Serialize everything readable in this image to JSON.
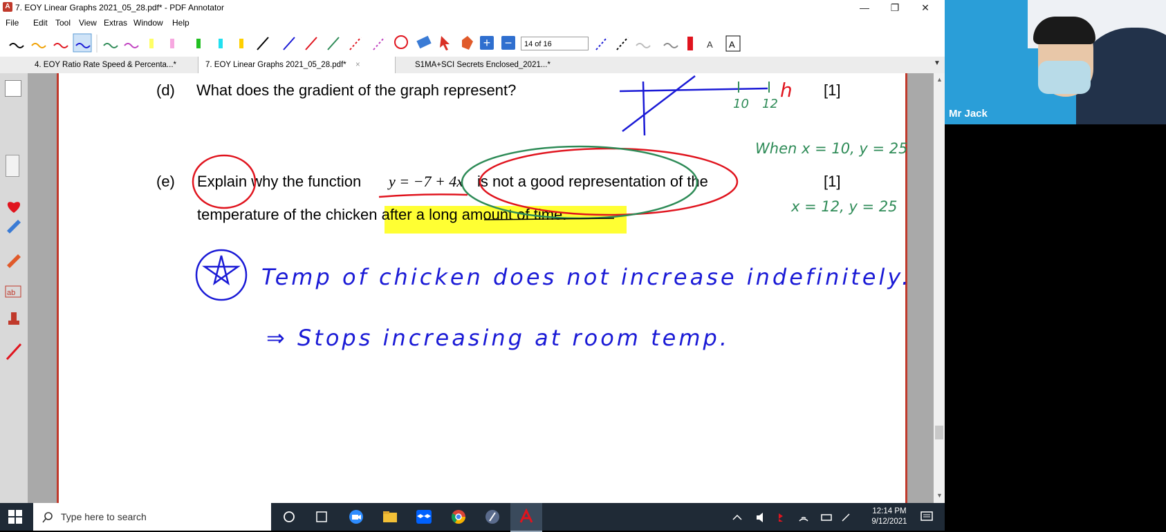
{
  "window": {
    "title": "7. EOY Linear Graphs 2021_05_28.pdf* - PDF Annotator",
    "controls": [
      "—",
      "❐",
      "✕"
    ]
  },
  "menu": [
    "File",
    "Edit",
    "Tool",
    "View",
    "Extras",
    "Window",
    "Help"
  ],
  "toolbar": {
    "page_indicator": "14 of 16",
    "plus_label": "+",
    "minus_label": "−"
  },
  "tabs": [
    {
      "label": "4. EOY Ratio Rate Speed & Percenta...*",
      "active": false
    },
    {
      "label": "7. EOY Linear Graphs 2021_05_28.pdf*",
      "active": true
    },
    {
      "label": "S1MA+SCI Secrets Enclosed_2021...*",
      "active": false
    }
  ],
  "document": {
    "q_d_label": "(d)",
    "q_d_text": "What does the gradient of the graph represent?",
    "q_d_marks": "[1]",
    "q_e_label": "(e)",
    "q_e_text_1a": "Explain why the function",
    "q_e_formula": "y = −7 + 4x",
    "q_e_text_1b": "is not a good representation of the",
    "q_e_text_2": "temperature of the chicken after a long amount of time.",
    "q_e_marks": "[1]",
    "ink_green_1": "When x = 10, y = 25",
    "ink_green_2": "x = 12, y = 25",
    "ink_axis_10": "10",
    "ink_axis_12": "12",
    "ink_h": "h",
    "ink_blue_line1": "Temp of chicken does not increase indefinitely.",
    "ink_blue_line2": "⇒ Stops increasing at room temp."
  },
  "webcam": {
    "name": "Mr Jack"
  },
  "taskbar": {
    "search_placeholder": "Type here to search",
    "time": "12:14 PM",
    "date": "9/12/2021"
  },
  "colors": {
    "ink_blue": "#1a1ad6",
    "ink_green": "#2e8b57",
    "ink_red": "#e0141e",
    "highlight": "#ffff33",
    "page_border": "#c0392b"
  }
}
